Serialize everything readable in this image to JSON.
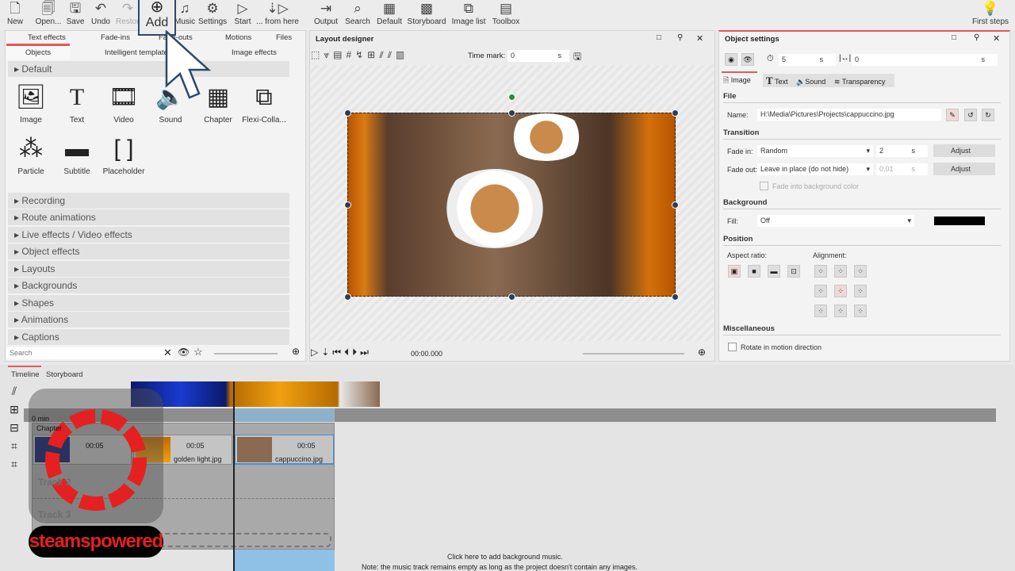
{
  "toolbar": {
    "new": "New",
    "open": "Open...",
    "save": "Save",
    "undo": "Undo",
    "restore": "Restore",
    "add": "Add",
    "music": "Music",
    "settings": "Settings",
    "start": "Start",
    "from_here": "... from here",
    "output": "Output",
    "search": "Search",
    "default": "Default",
    "storyboard": "Storyboard",
    "image_list": "Image list",
    "toolbox": "Toolbox",
    "first_steps": "First steps"
  },
  "left": {
    "tabs_row1": [
      "Text effects",
      "Fade-ins",
      "Fade-outs",
      "Motions",
      "Files"
    ],
    "tabs_row2": [
      "Objects",
      "Intelligent templates",
      "Image effects"
    ],
    "active_tab": "Objects",
    "group": "Default",
    "objects": [
      "Image",
      "Text",
      "Video",
      "Sound",
      "Chapter",
      "Flexi-Colla...",
      "Particle",
      "Subtitle",
      "Placeholder"
    ],
    "categories": [
      "Recording",
      "Route animations",
      "Live effects / Video effects",
      "Object effects",
      "Layouts",
      "Backgrounds",
      "Shapes",
      "Animations",
      "Captions"
    ],
    "search_placeholder": "Search"
  },
  "designer": {
    "title": "Layout designer",
    "time_mark_label": "Time mark:",
    "time_mark_value": "0",
    "time_unit": "s",
    "time": "00:00.000"
  },
  "settings": {
    "title": "Object settings",
    "duration": "5",
    "duration_unit": "s",
    "offset": "0",
    "offset_unit": "s",
    "tabs": [
      "Image",
      "Text",
      "Sound",
      "Transparency"
    ],
    "file_section": "File",
    "name_label": "Name:",
    "name_value": "H:\\Media\\Pictures\\Projects\\cappuccino.jpg",
    "transition_section": "Transition",
    "fade_in_label": "Fade in:",
    "fade_in_value": "Random",
    "fade_in_time": "2",
    "fade_out_label": "Fade out:",
    "fade_out_value": "Leave in place (do not hide)",
    "fade_out_time": "0,01",
    "unit": "s",
    "adjust": "Adjust",
    "fade_bg": "Fade into background color",
    "background_section": "Background",
    "fill_label": "Fill:",
    "fill_value": "Off",
    "fill_color": "#000000",
    "position_section": "Position",
    "aspect_label": "Aspect ratio:",
    "alignment_label": "Alignment:",
    "misc_section": "Miscellaneous",
    "rotate_label": "Rotate in motion direction"
  },
  "timeline": {
    "tabs": [
      "Timeline",
      "Storyboard"
    ],
    "ruler_label": "0 min",
    "chapter": "Chapter",
    "clips": [
      {
        "name": "",
        "duration": "00:05"
      },
      {
        "name": "golden light.jpg",
        "duration": "00:05"
      },
      {
        "name": "cappuccino.jpg",
        "duration": "00:05"
      }
    ],
    "tracks": [
      "Track 2",
      "Track 3"
    ],
    "music_hint": "Click here to add background music.",
    "music_note": "Note: the music track remains empty as long as the project doesn't contain any images."
  },
  "watermark": "steamspowered",
  "colors": {
    "accent": "#e05a5a",
    "selection": "#2a3d55",
    "timeline_highlight": "#8fc0e6"
  }
}
